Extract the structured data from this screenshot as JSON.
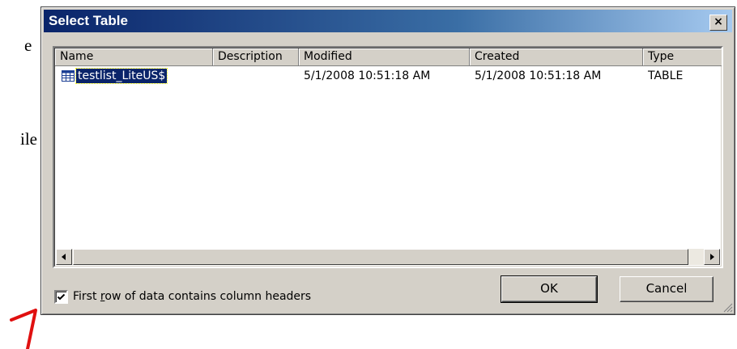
{
  "background_fragments": [
    "e",
    "ile"
  ],
  "dialog": {
    "title": "Select Table",
    "close_label": "×"
  },
  "listview": {
    "columns": [
      "Name",
      "Description",
      "Modified",
      "Created",
      "Type"
    ],
    "rows": [
      {
        "icon": "table-icon",
        "name": "testlist_LiteUS$",
        "description": "",
        "modified": "5/1/2008 10:51:18 AM",
        "created": "5/1/2008 10:51:18 AM",
        "type": "TABLE",
        "selected": true
      }
    ]
  },
  "options": {
    "first_row_headers_checked": true,
    "first_row_headers_pre": "First ",
    "first_row_headers_accel": "r",
    "first_row_headers_post": "ow of data contains column headers"
  },
  "buttons": {
    "ok": "OK",
    "cancel": "Cancel"
  },
  "colors": {
    "title_gradient_start": "#0a246a",
    "title_gradient_end": "#a6caf0",
    "dialog_face": "#d4d0c8",
    "selection": "#0a246a",
    "annotation_red": "#e01010"
  }
}
